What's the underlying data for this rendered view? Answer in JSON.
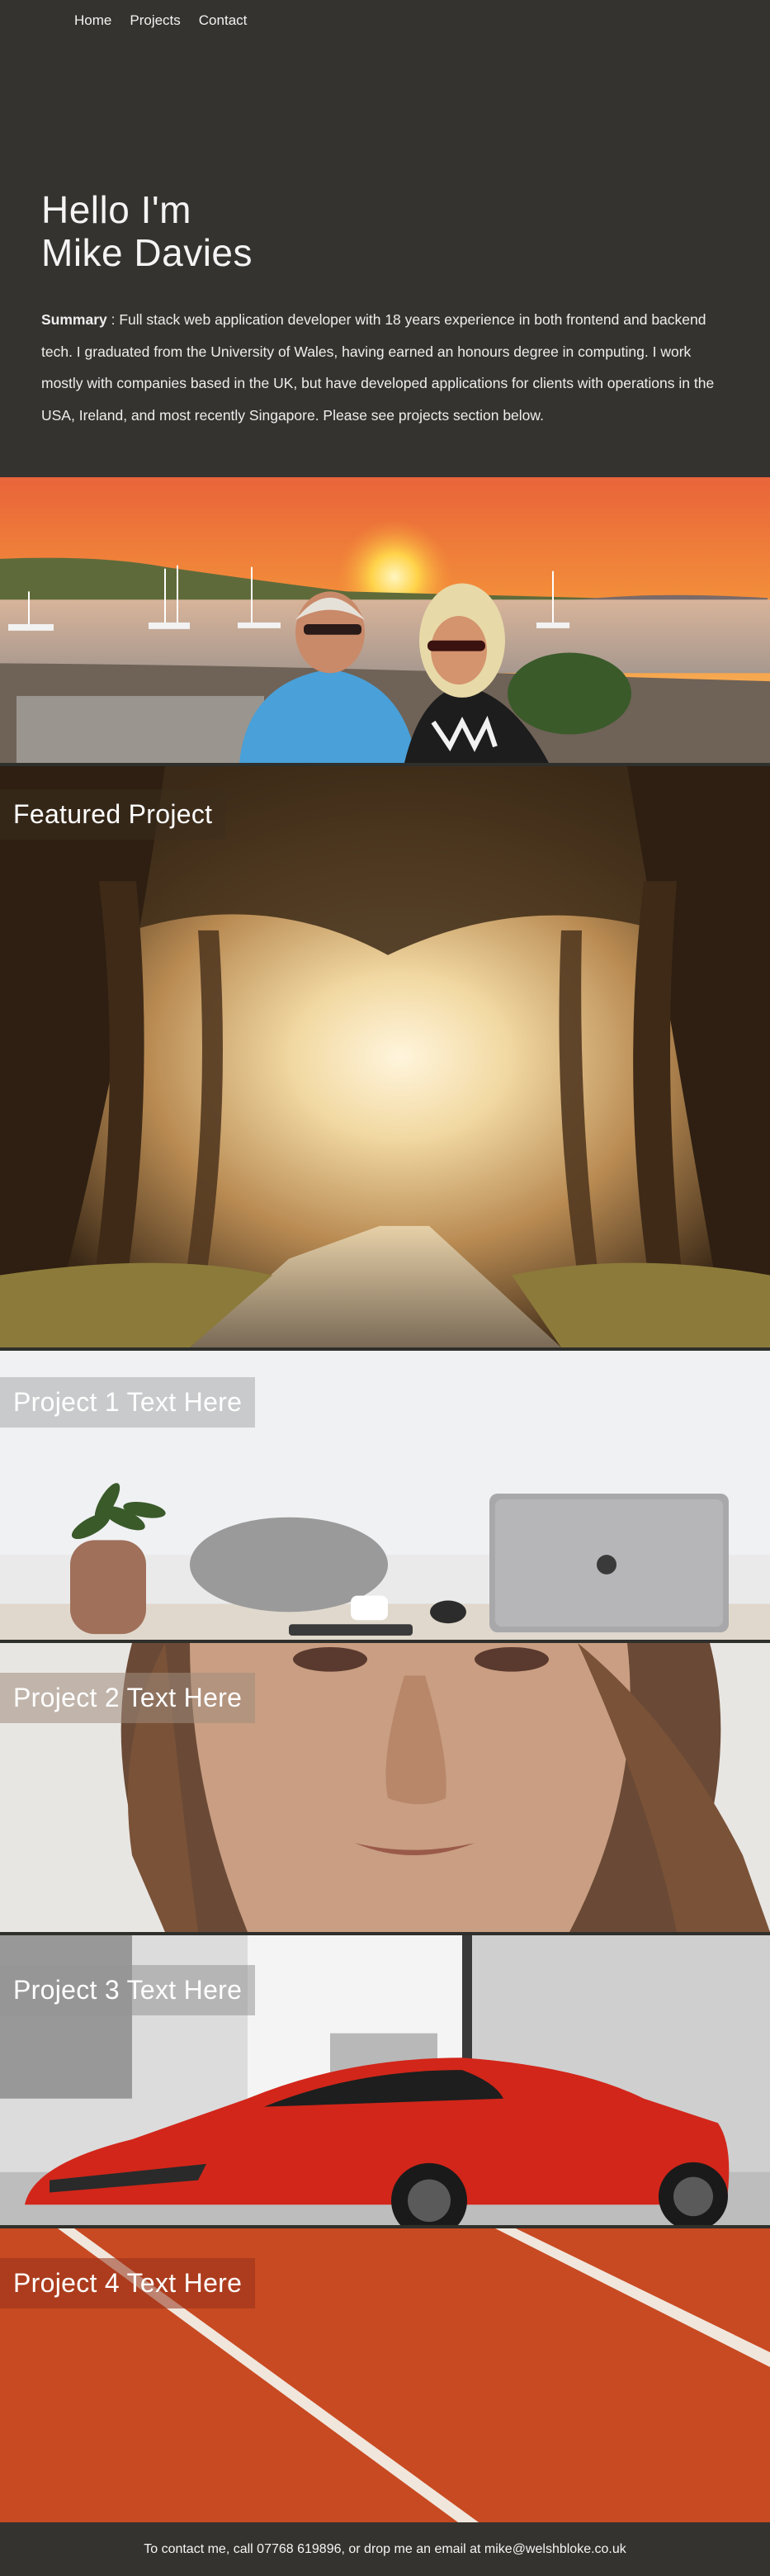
{
  "nav": {
    "items": [
      {
        "label": "Home"
      },
      {
        "label": "Projects"
      },
      {
        "label": "Contact"
      }
    ]
  },
  "hero": {
    "greeting_line1": "Hello I'm",
    "greeting_line2": "Mike Davies",
    "summary_label": "Summary",
    "summary_text": " : Full stack web application developer with 18 years experience in both frontend and backend tech. I graduated from the University of Wales, having earned an honours degree in computing. I work mostly with companies based in the UK, but have developed applications for clients with operations in the USA, Ireland, and most recently Singapore. Please see projects section below."
  },
  "sections": {
    "featured": {
      "title": "Featured Project"
    },
    "project1": {
      "title": "Project 1 Text Here"
    },
    "project2": {
      "title": "Project 2 Text Here"
    },
    "project3": {
      "title": "Project 3 Text Here"
    },
    "project4": {
      "title": "Project 4 Text Here"
    }
  },
  "footer": {
    "contact_text": "To contact me, call 07768 619896, or drop me an email at mike@welshbloke.co.uk"
  },
  "colors": {
    "background": "#34332f",
    "text": "#ffffff",
    "sunset": "#f59a3a",
    "track": "#c84a22",
    "car": "#d2261a"
  }
}
